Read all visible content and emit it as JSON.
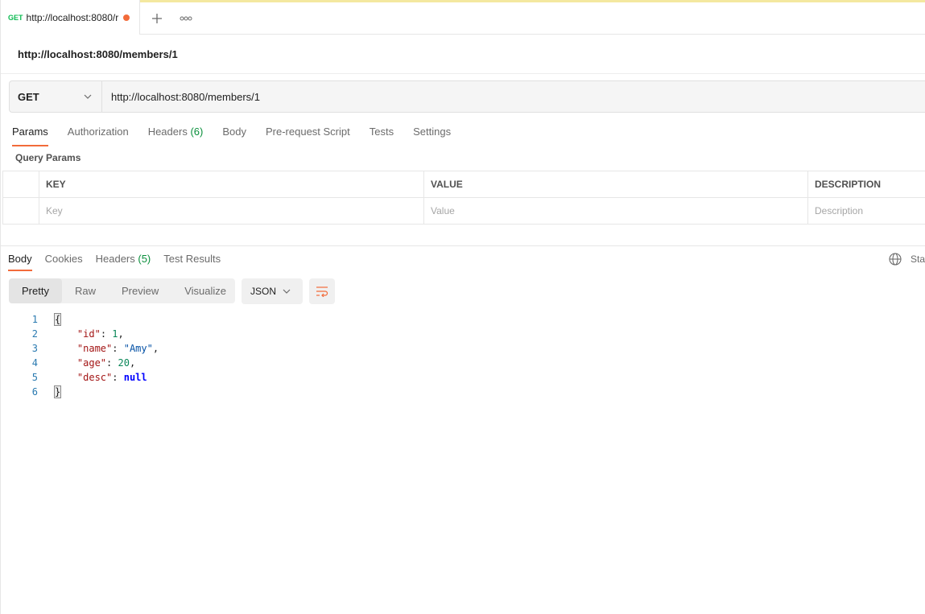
{
  "tab": {
    "method": "GET",
    "name": "http://localhost:8080/r"
  },
  "request": {
    "title": "http://localhost:8080/members/1",
    "method": "GET",
    "url": "http://localhost:8080/members/1"
  },
  "request_tabs": [
    {
      "label": "Params",
      "count": ""
    },
    {
      "label": "Authorization",
      "count": ""
    },
    {
      "label": "Headers",
      "count": "(6)"
    },
    {
      "label": "Body",
      "count": ""
    },
    {
      "label": "Pre-request Script",
      "count": ""
    },
    {
      "label": "Tests",
      "count": ""
    },
    {
      "label": "Settings",
      "count": ""
    }
  ],
  "query_params": {
    "label": "Query Params",
    "columns": [
      "KEY",
      "VALUE",
      "DESCRIPTION"
    ],
    "placeholders": [
      "Key",
      "Value",
      "Description"
    ]
  },
  "response_tabs": [
    {
      "label": "Body",
      "count": ""
    },
    {
      "label": "Cookies",
      "count": ""
    },
    {
      "label": "Headers",
      "count": "(5)"
    },
    {
      "label": "Test Results",
      "count": ""
    }
  ],
  "status_cut": "Sta",
  "view_modes": [
    "Pretty",
    "Raw",
    "Preview",
    "Visualize"
  ],
  "format": "JSON",
  "code": {
    "line_numbers": [
      "1",
      "2",
      "3",
      "4",
      "5",
      "6"
    ],
    "open_brace": "{",
    "close_brace": "}",
    "fields": [
      {
        "key": "\"id\"",
        "value": "1",
        "sep": ",",
        "kind": "number"
      },
      {
        "key": "\"name\"",
        "value": "\"Amy\"",
        "sep": ",",
        "kind": "string"
      },
      {
        "key": "\"age\"",
        "value": "20",
        "sep": ",",
        "kind": "number"
      },
      {
        "key": "\"desc\"",
        "value": "null",
        "sep": "",
        "kind": "null"
      }
    ]
  },
  "colors": {
    "accent": "#f26b3a",
    "get_method": "#0cbb52",
    "count": "#0a8f3c"
  }
}
